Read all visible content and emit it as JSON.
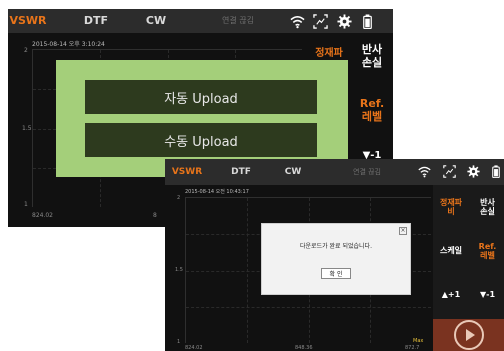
{
  "back": {
    "tabs": [
      "VSWR",
      "DTF",
      "CW"
    ],
    "connection_label": "연결 끊김",
    "timestamp": "2015-08-14 오후 3:10:24",
    "y_ticks": [
      "2",
      "1.5",
      "1"
    ],
    "x_tick_left": "824.02",
    "x_tick_mid": "8",
    "side_buttons": {
      "standing_wave": "정재파",
      "return_loss": "반사\n손실",
      "ref_level": "Ref.\n레벨",
      "down": "▼-1"
    },
    "upload": {
      "auto": "자동 Upload",
      "manual": "수동 Upload"
    }
  },
  "front": {
    "tabs": [
      "VSWR",
      "DTF",
      "CW"
    ],
    "connection_label": "연결 끊김",
    "timestamp": "2015-08-14 오전 10:43:17",
    "y_ticks": [
      "2",
      "1.5",
      "1"
    ],
    "x_tick_left": "824.02",
    "x_tick_mid": "848.36",
    "x_tick_right": "872.7",
    "marker_label": "Max",
    "side_buttons": {
      "standing_wave": "정재파\n비",
      "return_loss": "반사\n손실",
      "scale": "스케일",
      "ref_level": "Ref.\n레벨",
      "up": "▲+1",
      "down": "▼-1"
    },
    "dialog": {
      "message": "다운로드가 완료 되었습니다.",
      "ok": "확 인",
      "close": "×"
    }
  },
  "colors": {
    "accent_orange": "#e8741a",
    "panel_green": "#a4cf7a",
    "button_dark_green": "#2d3a1e",
    "play_panel": "#7a3320"
  }
}
